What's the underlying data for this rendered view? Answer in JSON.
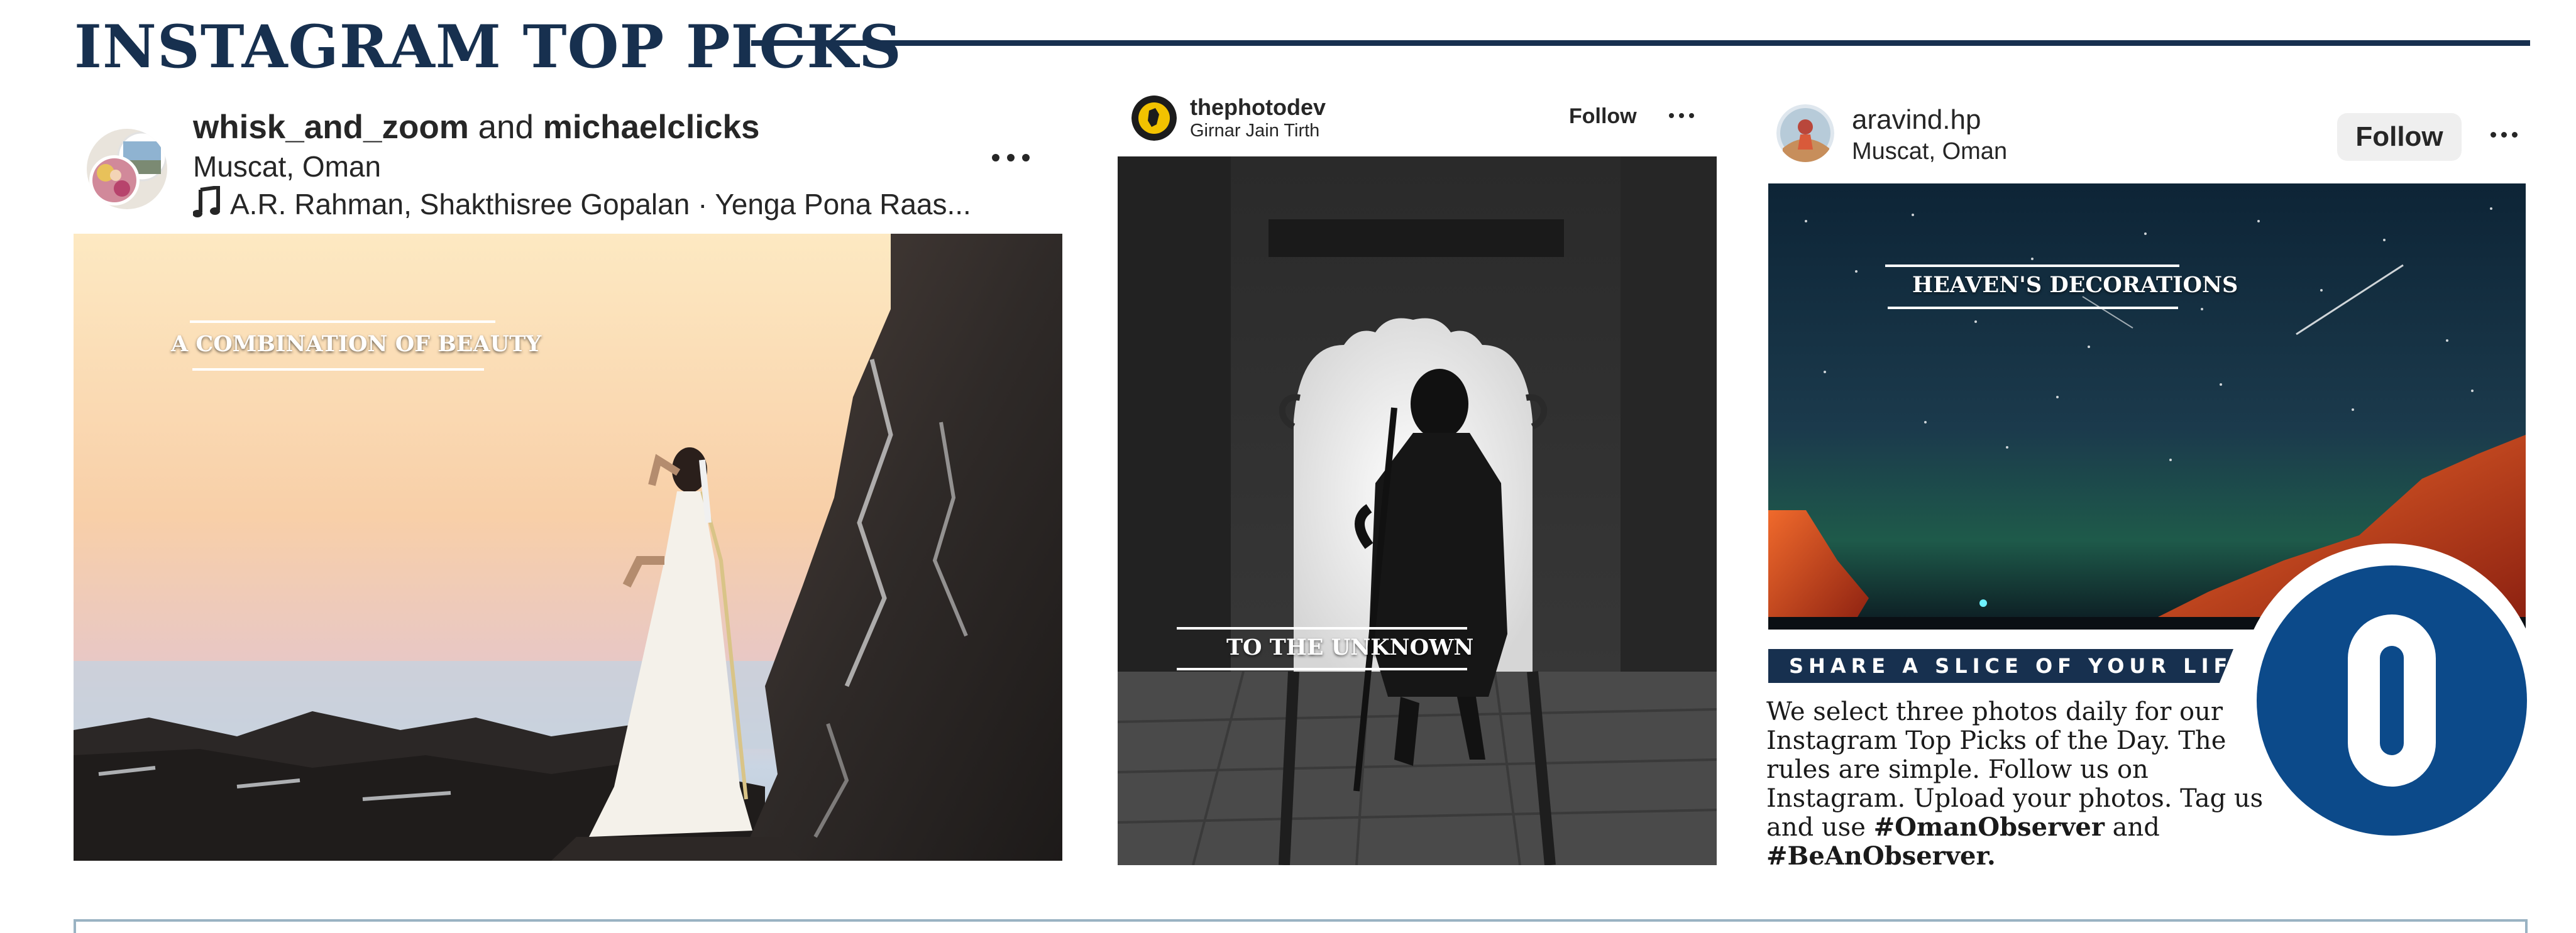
{
  "section": {
    "title": "INSTAGRAM TOP PICKS"
  },
  "post1": {
    "user_a": "whisk_and_zoom",
    "conjunction": "and",
    "user_b": "michaelclicks",
    "location": "Muscat, Oman",
    "music": "A.R. Rahman, Shakthisree Gopalan · Yenga Pona Raas...",
    "overlay": "A COMBINATION OF BEAUTY"
  },
  "post2": {
    "username": "thephotodev",
    "location": "Girnar Jain Tirth",
    "follow_label": "Follow",
    "overlay": "TO THE UNKNOWN"
  },
  "post3": {
    "username": "aravind.hp",
    "location": "Muscat, Oman",
    "follow_label": "Follow",
    "overlay": "HEAVEN'S DECORATIONS"
  },
  "share": {
    "banner": "SHARE A SLICE OF YOUR LIFE",
    "body_text": "We select three photos daily for our Instagram Top Picks of the Day. The rules are simple. Follow us on Instagram. Upload your photos. Tag us and use ",
    "hashtag_1": "#OmanObserver",
    "joiner": "and",
    "hashtag_2": "#BeAnObserver."
  },
  "colors": {
    "navy": "#17304f",
    "logo_blue": "#0c4a8a",
    "text": "#262626"
  },
  "icons": [
    "music-note-icon",
    "more-options-icon"
  ]
}
